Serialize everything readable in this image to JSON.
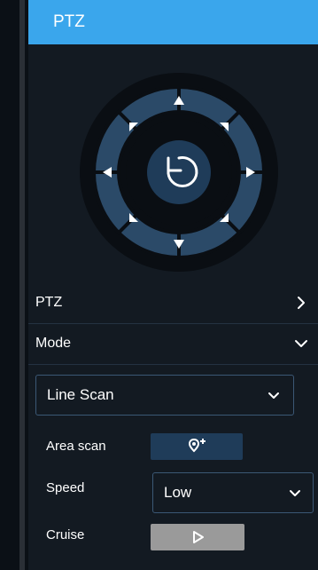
{
  "header": {
    "title": "PTZ"
  },
  "ptz_control": {
    "center_icon": "refresh-icon",
    "arrow_icons": [
      "up-arrow-icon",
      "up-right-arrow-icon",
      "right-arrow-icon",
      "down-right-arrow-icon",
      "down-arrow-icon",
      "down-left-arrow-icon",
      "left-arrow-icon",
      "up-left-arrow-icon"
    ]
  },
  "sections": {
    "ptz": {
      "label": "PTZ",
      "chevron": "chevron-right-icon"
    },
    "mode": {
      "label": "Mode",
      "chevron": "chevron-down-icon"
    }
  },
  "mode_select": {
    "value": "Line Scan"
  },
  "fields": {
    "area_scan": {
      "label": "Area scan",
      "icon": "area-scan-add-icon"
    },
    "speed": {
      "label": "Speed",
      "value": "Low"
    },
    "cruise": {
      "label": "Cruise",
      "icon": "play-icon"
    }
  },
  "colors": {
    "header_bg": "#3aa6ec",
    "panel_bg": "#131a22",
    "ring_outer": "#2b4a68",
    "button_dark": "#1f3c59",
    "cruise_button": "#9a9a9a"
  }
}
